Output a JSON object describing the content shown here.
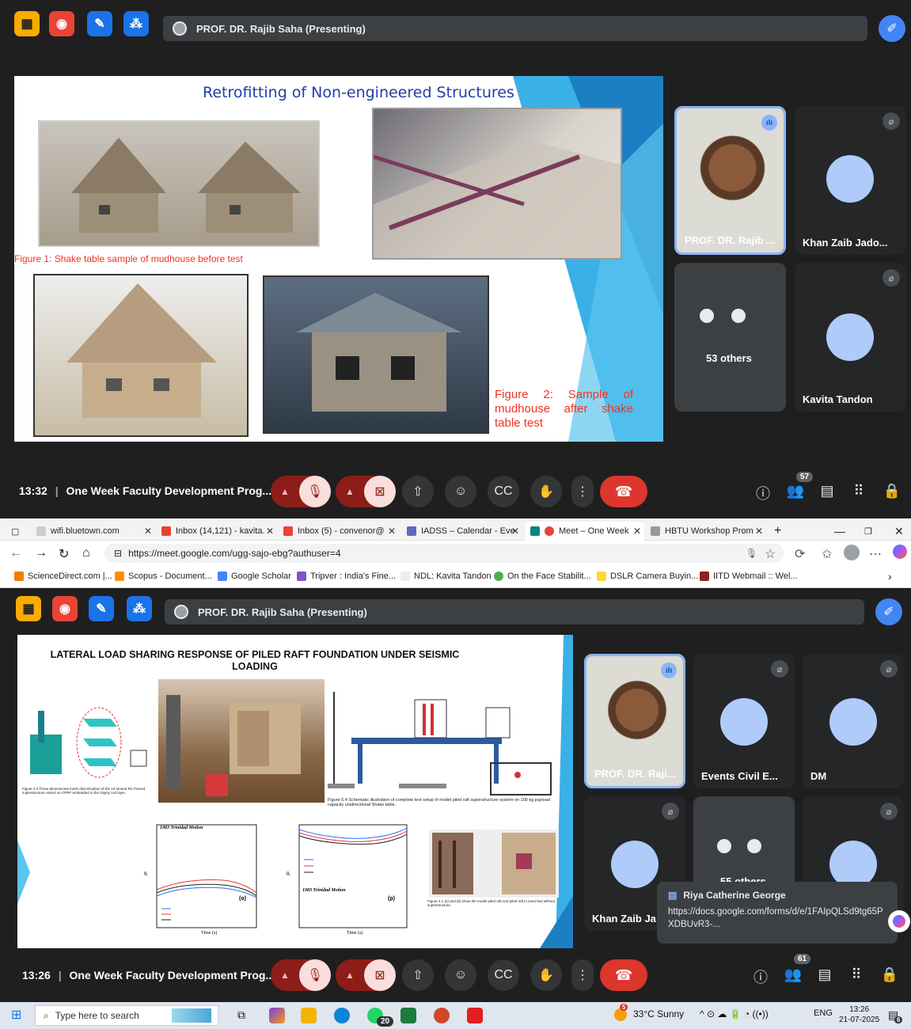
{
  "meet1": {
    "presenter_label": "PROF. DR. Rajib Saha (Presenting)",
    "slide": {
      "title": "Retrofitting of Non-engineered Structures",
      "caption1": "Figure 1: Shake table sample of mudhouse before test",
      "caption2": "Figure 2: Sample of mudhouse after shake table test"
    },
    "tiles": [
      {
        "name": "PROF. DR. Rajib ..."
      },
      {
        "name": "Khan Zaib Jado..."
      },
      {
        "name": "53 others"
      },
      {
        "name": "Kavita Tandon"
      }
    ],
    "time": "13:32",
    "meeting_title": "One Week Faculty Development Prog...",
    "people_count": "57"
  },
  "browser": {
    "tabs": [
      {
        "label": "wifi.bluetown.com",
        "color": "#cccccc"
      },
      {
        "label": "Inbox (14,121) - kavita.",
        "color": "#ea4335"
      },
      {
        "label": "Inbox (5) - convenor@",
        "color": "#ea4335"
      },
      {
        "label": "IADSS – Calendar - Eve",
        "color": "#5b6abf"
      },
      {
        "label": "Meet – One Week",
        "color": "#00897b"
      },
      {
        "label": "HBTU Workshop Prom",
        "color": "#999999"
      }
    ],
    "url": "https://meet.google.com/ugg-sajo-ebg?authuser=4",
    "bookmarks": [
      {
        "label": "ScienceDirect.com |...",
        "color": "#f57c00"
      },
      {
        "label": "Scopus - Document...",
        "color": "#ff8f00"
      },
      {
        "label": "Google Scholar",
        "color": "#4285f4"
      },
      {
        "label": "Tripver : India's Fine...",
        "color": "#7e57c2"
      },
      {
        "label": "NDL: Kavita Tandon",
        "color": "#ffffff"
      },
      {
        "label": "On the Face Stabilit...",
        "color": "#4caf50"
      },
      {
        "label": "DSLR Camera Buyin...",
        "color": "#fdd835"
      },
      {
        "label": "IITD Webmail :: Wel...",
        "color": "#8d2222"
      }
    ]
  },
  "meet2": {
    "presenter_label": "PROF. DR. Rajib Saha (Presenting)",
    "slide": {
      "title": "LATERAL LOAD SHARING RESPONSE OF PILED RAFT FOUNDATION UNDER SEISMIC LOADING",
      "fig_caption_a": "Figure 4.3 Three-dimensional mesh discretization of the 10-storied RC framed superstructure rested on CPRF embedded in the clayey soil layer.",
      "fig_caption_b": "Figure 5.4 Schematic illustration of complete test setup of model piled raft superstructure system on 100 kg payload capacity unidirectional Shake table.",
      "plot1": {
        "title": "1983 Trinidad Motion",
        "xlabel": "Time (s)",
        "label": "(o)",
        "ylabel": "θᵣ"
      },
      "plot2": {
        "title": "1983 Trinidad Motion",
        "xlabel": "Time (s)",
        "label": "(p)",
        "ylabel": "θᵣ"
      },
      "fig_caption_c": "Figure 4.1 (a) and (b) show the model piled raft and piled raft in sand bed without superstructure."
    },
    "tiles": [
      {
        "name": "PROF. DR. Raji..."
      },
      {
        "name": "Events Civil E..."
      },
      {
        "name": "DM"
      },
      {
        "name": "Khan Zaib Ja"
      },
      {
        "name": "55 others"
      },
      {
        "name": ""
      }
    ],
    "time": "13:26",
    "meeting_title": "One Week Faculty Development Prog...",
    "people_count": "61",
    "popup": {
      "sender": "Riya Catherine George",
      "message": "https://docs.google.com/forms/d/e/1FAIpQLSd9tg65PXDBUvR3-..."
    }
  },
  "taskbar": {
    "search_placeholder": "Type here to search",
    "whatsapp_badge": "20",
    "weather_badge": "5",
    "weather": "33°C  Sunny",
    "lang": "ENG",
    "time": "13:26",
    "date": "21-07-2025",
    "notif_count": "6"
  }
}
